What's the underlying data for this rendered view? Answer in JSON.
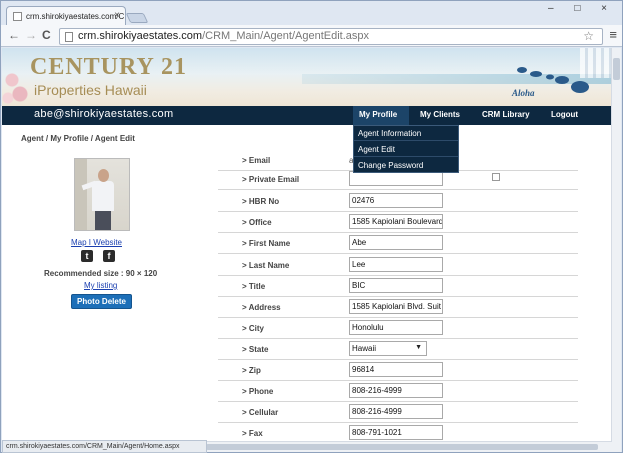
{
  "browser": {
    "tab_title": "crm.shirokiyaestates.com/C",
    "tab_close": "×",
    "url_host": "crm.shirokiyaestates.com",
    "url_path": "/CRM_Main/Agent/AgentEdit.aspx",
    "back": "←",
    "forward": "→",
    "reload": "C",
    "star": "☆",
    "menu": "≡",
    "window_controls": "– □ ×",
    "status_url": "crm.shirokiyaestates.com/CRM_Main/Agent/Home.aspx"
  },
  "banner": {
    "logo_main": "CENTURY 21",
    "logo_sub": "iProperties Hawaii",
    "tagline": "Aloha"
  },
  "nav": {
    "email": "abe@shirokiyaestates.com",
    "items": [
      "My Profile",
      "My Clients",
      "CRM Library",
      "Logout"
    ],
    "dropdown": [
      "Agent Information",
      "Agent Edit",
      "Change Password"
    ]
  },
  "breadcrumb": "Agent / My Profile / Agent Edit",
  "sidebar": {
    "map_link": "Map I Website",
    "twitter": "t",
    "facebook": "f",
    "recommended_size": "Recommended size : 90 × 120",
    "my_listing": "My listing",
    "photo_delete": "Photo Delete"
  },
  "form": {
    "email": {
      "label": "> Email",
      "value": "a"
    },
    "private_email": {
      "label": "> Private Email",
      "value": ""
    },
    "hbr_no": {
      "label": "> HBR No",
      "value": "02476"
    },
    "office": {
      "label": "> Office",
      "value": "1585 Kapiolani Boulevard,"
    },
    "first_name": {
      "label": "> First Name",
      "value": "Abe"
    },
    "last_name": {
      "label": "> Last Name",
      "value": "Lee"
    },
    "title": {
      "label": "> Title",
      "value": "BIC"
    },
    "address": {
      "label": "> Address",
      "value": "1585 Kapiolani Blvd.  Suit"
    },
    "city": {
      "label": "> City",
      "value": "Honolulu"
    },
    "state": {
      "label": "> State",
      "value": "Hawaii"
    },
    "zip": {
      "label": "> Zip",
      "value": "96814"
    },
    "phone": {
      "label": "> Phone",
      "value": "808-216-4999"
    },
    "cellular": {
      "label": "> Cellular",
      "value": "808-216-4999"
    },
    "fax": {
      "label": "> Fax",
      "value": "808-791-1021"
    }
  },
  "colors": {
    "navbar": "#0d2840",
    "button": "#1d6fb8",
    "link": "#1a3fb0"
  }
}
